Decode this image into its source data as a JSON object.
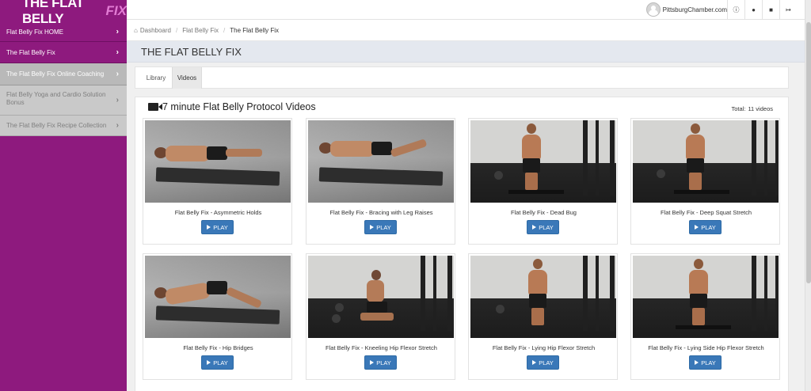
{
  "brand": {
    "name": "THE FLAT BELLY",
    "accent": "FIX",
    "color": "#8e1a7e"
  },
  "sidebar": {
    "items": [
      {
        "label": "Flat Belly Fix HOME",
        "state": "normal"
      },
      {
        "label": "The Flat Belly Fix",
        "state": "normal"
      },
      {
        "label": "The Flat Belly Fix Online Coaching",
        "state": "active"
      },
      {
        "label": "Flat Belly Yoga and Cardio Solution Bonus",
        "state": "disabled"
      },
      {
        "label": "The Flat Belly Fix Recipe Collection",
        "state": "disabled"
      }
    ]
  },
  "topbar": {
    "user": "PittsburgChamber.com",
    "icons": [
      "info-icon",
      "dashboard-icon",
      "chat-icon",
      "logout-icon"
    ]
  },
  "breadcrumb": {
    "items": [
      "Dashboard",
      "Flat Belly Fix",
      "The Flat Belly Fix"
    ]
  },
  "page": {
    "title": "THE FLAT BELLY FIX"
  },
  "tabs": {
    "items": [
      {
        "label": "Library",
        "active": false
      },
      {
        "label": "Videos",
        "active": true
      }
    ]
  },
  "videos": {
    "title": "7 minute Flat Belly Protocol Videos",
    "total_label": "Total:",
    "total_value": "11 videos",
    "play_label": "PLAY",
    "items": [
      {
        "title": "Flat Belly Fix - Asymmetric Holds"
      },
      {
        "title": "Flat Belly Fix - Bracing with Leg Raises"
      },
      {
        "title": "Flat Belly Fix - Dead Bug"
      },
      {
        "title": "Flat Belly Fix - Deep Squat Stretch"
      },
      {
        "title": "Flat Belly Fix - Hip Bridges"
      },
      {
        "title": "Flat Belly Fix - Kneeling Hip Flexor Stretch"
      },
      {
        "title": "Flat Belly Fix - Lying Hip Flexor Stretch"
      },
      {
        "title": "Flat Belly Fix - Lying Side Hip Flexor Stretch"
      }
    ]
  }
}
